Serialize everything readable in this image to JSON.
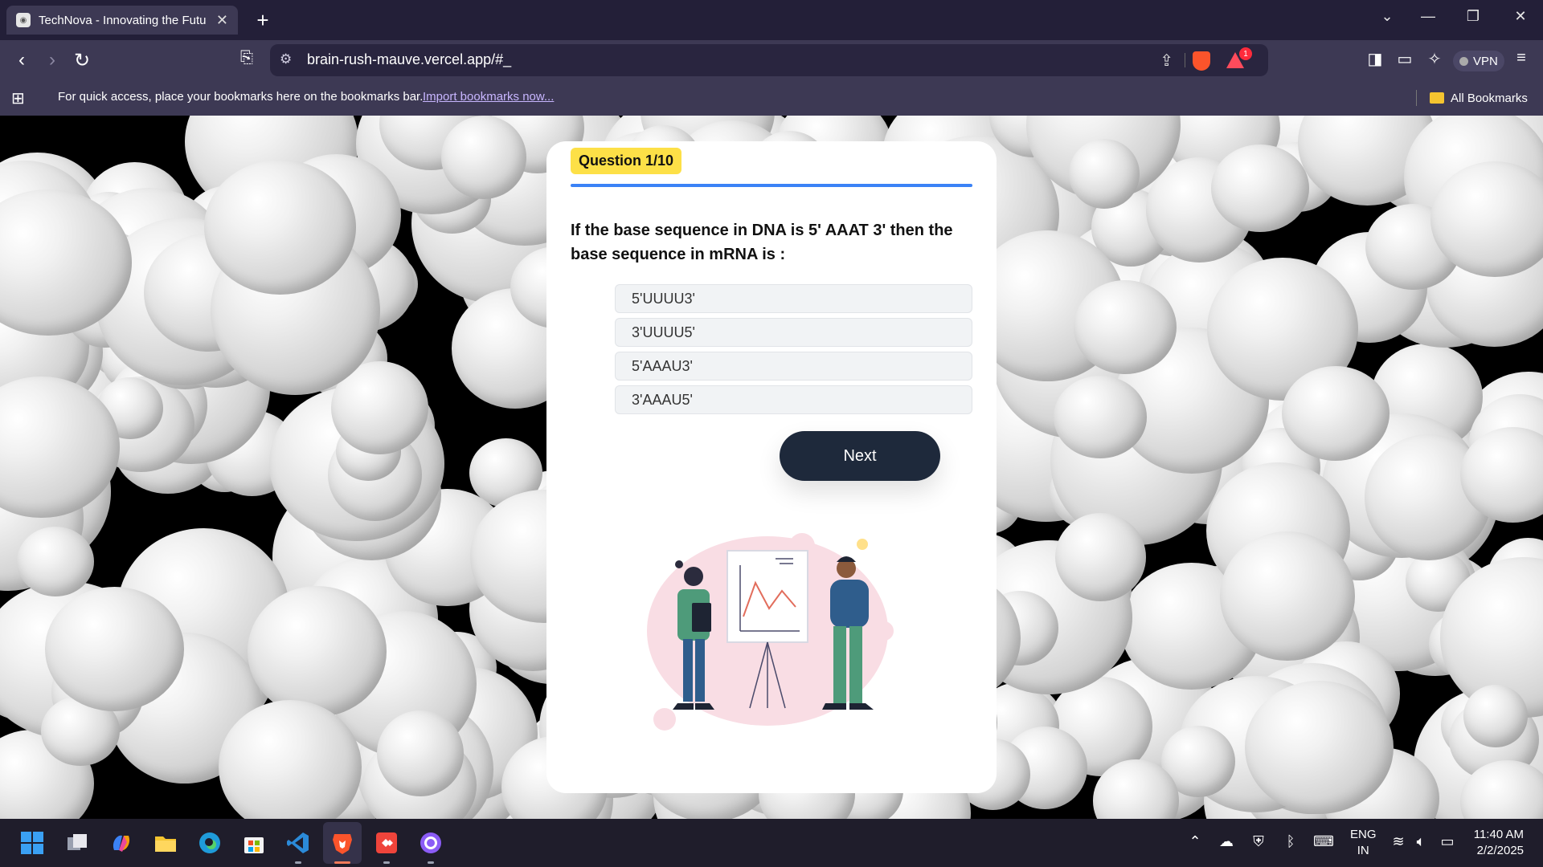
{
  "browser": {
    "tab_title": "TechNova - Innovating the Futu",
    "url": "brain-rush-mauve.vercel.app/#_",
    "rewards_badge": "1",
    "vpn_label": "VPN",
    "bookmarks_message": "For quick access, place your bookmarks here on the bookmarks bar.",
    "import_link": "Import bookmarks now...",
    "all_bookmarks": "All Bookmarks"
  },
  "quiz": {
    "counter": "Question 1/10",
    "question": "If the base sequence in DNA is 5' AAAT 3' then the base sequence in mRNA is :",
    "options": [
      "5'UUUU3'",
      "3'UUUU5'",
      "5'AAAU3'",
      "3'AAAU5'"
    ],
    "next_label": "Next",
    "progress_color": "#3b82f6",
    "badge_color": "#fde047"
  },
  "taskbar": {
    "apps": [
      "windows-start",
      "task-view",
      "copilot",
      "file-explorer",
      "edge",
      "microsoft-store",
      "vs-code",
      "brave",
      "anydesk",
      "github-desktop"
    ],
    "language": "ENG",
    "region": "IN",
    "time": "11:40 AM",
    "date": "2/2/2025"
  }
}
